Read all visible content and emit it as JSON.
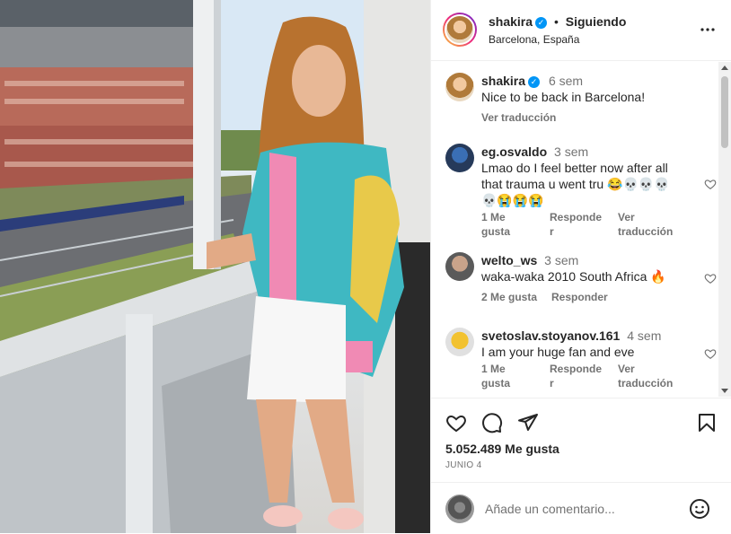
{
  "post": {
    "author": "shakira",
    "follow_sep": "•",
    "follow_state": "Siguiendo",
    "location": "Barcelona, España",
    "caption": "Nice to be back in Barcelona!",
    "caption_time": "6 sem",
    "translate": "Ver traducción",
    "likes": "5.052.489 Me gusta",
    "date": "JUNIO 4",
    "comment_placeholder": "Añade un comentario..."
  },
  "comments": [
    {
      "user": "eg.osvaldo",
      "time": "3 sem",
      "text_1": "Lmao do I feel better now after all",
      "text_2": "that trauma u went tru 😂💀💀💀",
      "text_3": "💀😭😭😭",
      "likes": "1 Me gusta",
      "reply": "Responder",
      "translate": "Ver traducción"
    },
    {
      "user": "welto_ws",
      "time": "3 sem",
      "text_1": "waka-waka 2010 South Africa 🔥",
      "likes": "2 Me gusta",
      "reply": "Responder"
    },
    {
      "user": "svetoslav.stoyanov.161",
      "time": "4 sem",
      "text_1": "I am your huge fan and eve",
      "likes": "1 Me gusta",
      "reply": "Responder",
      "translate": "Ver traducción"
    }
  ],
  "meta_labels": {
    "likes_1a": "1 Me",
    "likes_1b": "gusta",
    "reply_a": "Responde",
    "reply_b": "r",
    "tr_a": "Ver",
    "tr_b": "traducción"
  },
  "icons": [
    "more-options-icon",
    "verified-icon",
    "heart-icon",
    "comment-icon",
    "share-icon",
    "bookmark-icon",
    "emoji-icon"
  ],
  "colors": {
    "verified": "#0095f6",
    "muted": "#737373",
    "text": "#262626"
  }
}
